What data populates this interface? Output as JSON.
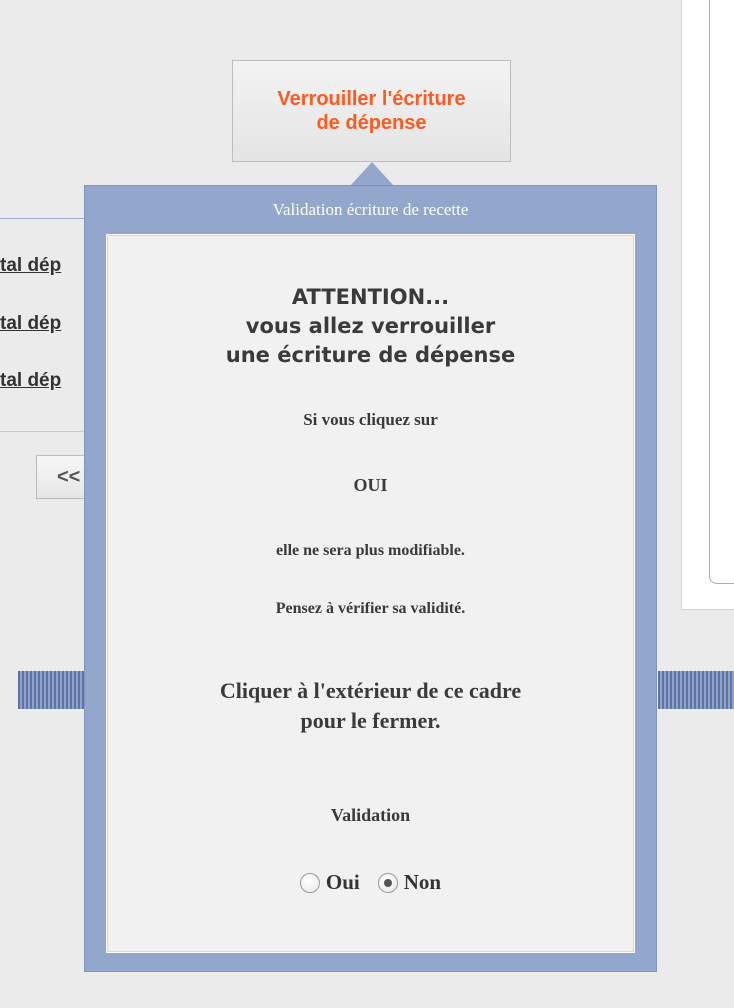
{
  "lock_button": {
    "label_line1": "Verrouiller l'écriture",
    "label_line2": "de dépense"
  },
  "background": {
    "links": [
      "tal dép",
      "tal dép",
      "tal dép"
    ],
    "prev_button": "<<"
  },
  "popup": {
    "title": "Validation écriture de recette",
    "attention": [
      "ATTENTION...",
      "vous allez verrouiller",
      "une écriture de dépense"
    ],
    "if_click": "Si vous cliquez sur",
    "yes_caps": "OUI",
    "no_longer": "elle ne sera plus modifiable.",
    "check_valid": "Pensez à vérifier sa validité.",
    "close_hint": [
      "Cliquer à l'extérieur de ce cadre",
      "pour le fermer."
    ],
    "validation_label": "Validation",
    "options": [
      {
        "label": "Oui",
        "checked": false
      },
      {
        "label": "Non",
        "checked": true
      }
    ]
  },
  "colors": {
    "accent_orange": "#ff5a1f",
    "popup_frame": "#93a6cc",
    "stripe": "#5d74a5"
  }
}
